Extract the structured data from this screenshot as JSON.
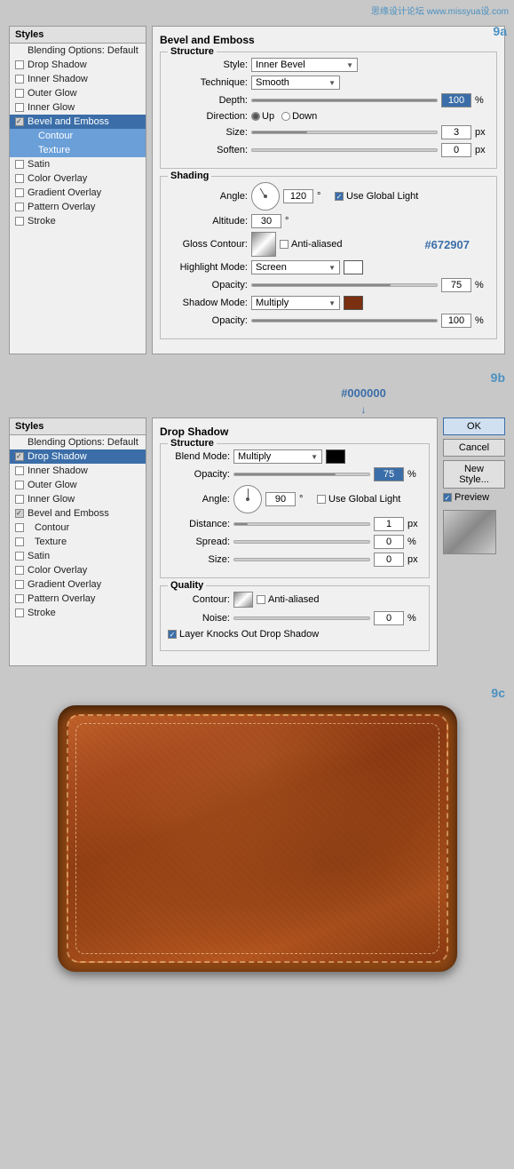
{
  "watermark": "思缘设计论坛 www.missyua设.com",
  "label_9a": "9a",
  "label_9b": "9b",
  "label_9c": "9c",
  "hex_color_a": "#672907",
  "hex_color_b": "#000000",
  "panelA": {
    "main_title": "Bevel and Emboss",
    "structure_title": "Structure",
    "shading_title": "Shading",
    "style_label": "Style:",
    "style_value": "Inner Bevel",
    "technique_label": "Technique:",
    "technique_value": "Smooth",
    "depth_label": "Depth:",
    "depth_value": "100",
    "depth_unit": "%",
    "direction_label": "Direction:",
    "direction_up": "Up",
    "direction_down": "Down",
    "size_label": "Size:",
    "size_value": "3",
    "size_unit": "px",
    "soften_label": "Soften:",
    "soften_value": "0",
    "soften_unit": "px",
    "angle_label": "Angle:",
    "angle_value": "120",
    "angle_unit": "°",
    "use_global_light": "Use Global Light",
    "altitude_label": "Altitude:",
    "altitude_value": "30",
    "altitude_unit": "°",
    "gloss_contour_label": "Gloss Contour:",
    "anti_aliased": "Anti-aliased",
    "highlight_mode_label": "Highlight Mode:",
    "highlight_mode_value": "Screen",
    "highlight_opacity": "75",
    "shadow_mode_label": "Shadow Mode:",
    "shadow_mode_value": "Multiply",
    "shadow_opacity": "100",
    "opacity_label": "Opacity:",
    "opacity_unit": "%"
  },
  "sidebar_a": {
    "title": "Styles",
    "blending_options": "Blending Options: Default",
    "items": [
      {
        "label": "Drop Shadow",
        "checked": false,
        "highlighted": false
      },
      {
        "label": "Inner Shadow",
        "checked": false,
        "highlighted": false
      },
      {
        "label": "Outer Glow",
        "checked": false,
        "highlighted": false
      },
      {
        "label": "Inner Glow",
        "checked": false,
        "highlighted": false
      },
      {
        "label": "Bevel and Emboss",
        "checked": true,
        "highlighted": true
      },
      {
        "label": "Contour",
        "checked": false,
        "highlighted": false,
        "sub": true
      },
      {
        "label": "Texture",
        "checked": false,
        "highlighted": false,
        "sub": true
      },
      {
        "label": "Satin",
        "checked": false,
        "highlighted": false
      },
      {
        "label": "Color Overlay",
        "checked": false,
        "highlighted": false
      },
      {
        "label": "Gradient Overlay",
        "checked": false,
        "highlighted": false
      },
      {
        "label": "Pattern Overlay",
        "checked": false,
        "highlighted": false
      },
      {
        "label": "Stroke",
        "checked": false,
        "highlighted": false
      }
    ]
  },
  "sidebar_b": {
    "title": "Styles",
    "blending_options": "Blending Options: Default",
    "items": [
      {
        "label": "Drop Shadow",
        "checked": true,
        "highlighted": true
      },
      {
        "label": "Inner Shadow",
        "checked": false,
        "highlighted": false
      },
      {
        "label": "Outer Glow",
        "checked": false,
        "highlighted": false
      },
      {
        "label": "Inner Glow",
        "checked": false,
        "highlighted": false
      },
      {
        "label": "Bevel and Emboss",
        "checked": true,
        "highlighted": false
      },
      {
        "label": "Contour",
        "checked": false,
        "highlighted": false,
        "sub": true
      },
      {
        "label": "Texture",
        "checked": false,
        "highlighted": false,
        "sub": true
      },
      {
        "label": "Satin",
        "checked": false,
        "highlighted": false
      },
      {
        "label": "Color Overlay",
        "checked": false,
        "highlighted": false
      },
      {
        "label": "Gradient Overlay",
        "checked": false,
        "highlighted": false
      },
      {
        "label": "Pattern Overlay",
        "checked": false,
        "highlighted": false
      },
      {
        "label": "Stroke",
        "checked": false,
        "highlighted": false
      }
    ]
  },
  "panelB": {
    "main_title": "Drop Shadow",
    "structure_title": "Structure",
    "quality_title": "Quality",
    "blend_mode_label": "Blend Mode:",
    "blend_mode_value": "Multiply",
    "opacity_label": "Opacity:",
    "opacity_value": "75",
    "opacity_unit": "%",
    "angle_label": "Angle:",
    "angle_value": "90",
    "angle_unit": "°",
    "use_global_light": "Use Global Light",
    "distance_label": "Distance:",
    "distance_value": "1",
    "distance_unit": "px",
    "spread_label": "Spread:",
    "spread_value": "0",
    "spread_unit": "%",
    "size_label": "Size:",
    "size_value": "0",
    "size_unit": "px",
    "contour_label": "Contour:",
    "anti_aliased": "Anti-aliased",
    "noise_label": "Noise:",
    "noise_value": "0",
    "noise_unit": "%",
    "layer_knocks": "Layer Knocks Out Drop Shadow",
    "ok_label": "OK",
    "cancel_label": "Cancel",
    "new_style_label": "New Style...",
    "preview_label": "Preview"
  }
}
